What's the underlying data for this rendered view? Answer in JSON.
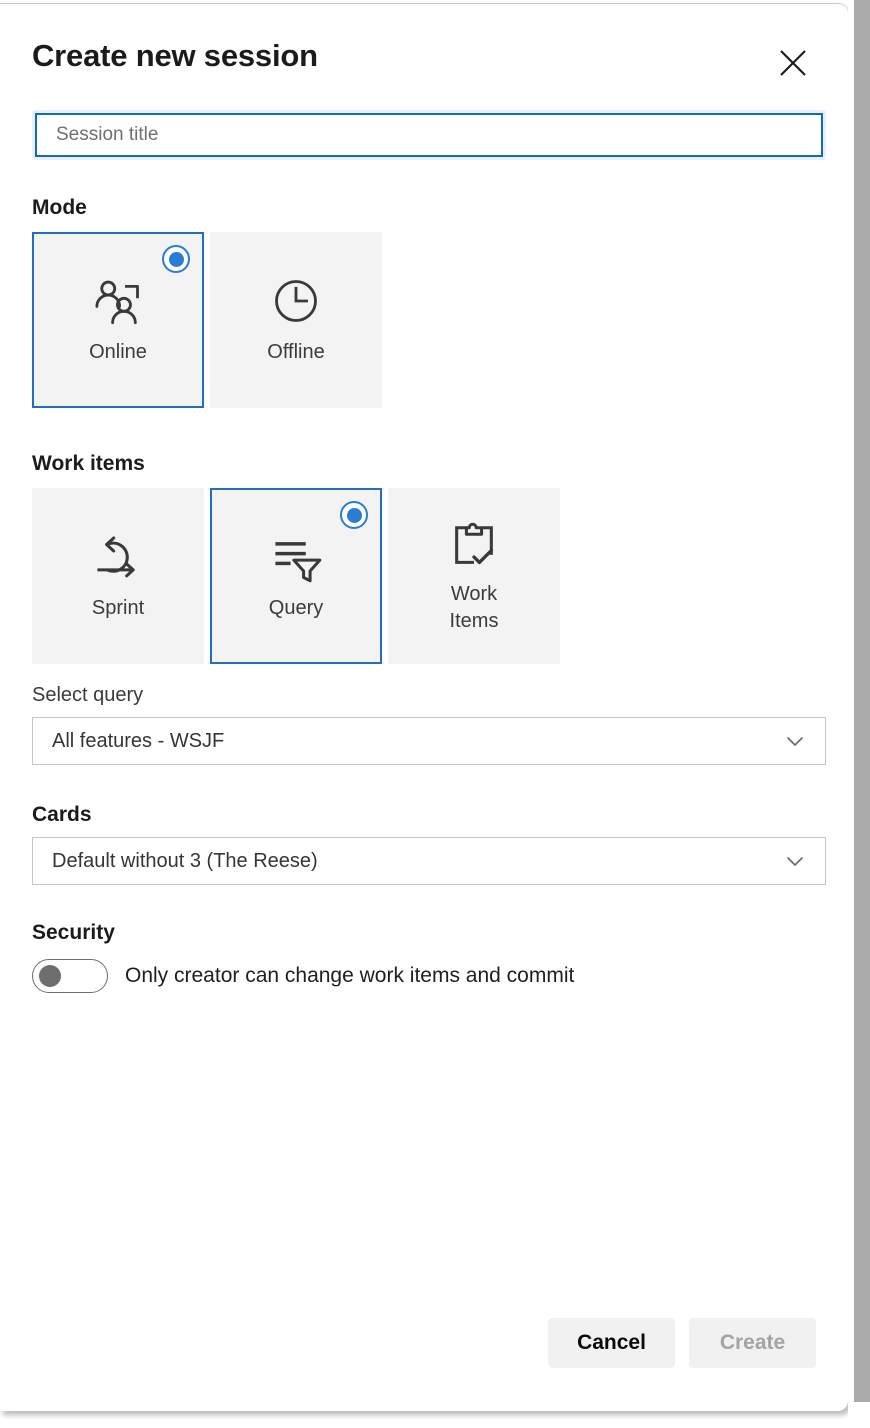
{
  "dialog": {
    "title": "Create new session",
    "close_icon": "close-icon"
  },
  "session_title": {
    "value": "",
    "placeholder": "Session title"
  },
  "mode": {
    "heading": "Mode",
    "selected": "Online",
    "options": [
      {
        "label": "Online",
        "icon": "people-group-icon",
        "selected": true
      },
      {
        "label": "Offline",
        "icon": "clock-icon",
        "selected": false
      }
    ]
  },
  "work_items": {
    "heading": "Work items",
    "selected": "Query",
    "options": [
      {
        "label": "Sprint",
        "icon": "sprint-loop-icon",
        "selected": false
      },
      {
        "label": "Query",
        "icon": "filter-lines-icon",
        "selected": true
      },
      {
        "label": "Work\nItems",
        "icon": "clipboard-check-icon",
        "selected": false
      }
    ],
    "query_field": {
      "label": "Select query",
      "value": "All features - WSJF",
      "chevron_icon": "chevron-down-icon"
    }
  },
  "cards": {
    "heading": "Cards",
    "value": "Default without 3 (The Reese)",
    "chevron_icon": "chevron-down-icon"
  },
  "security": {
    "heading": "Security",
    "toggle_label": "Only creator can change work items and commit",
    "toggle_on": false
  },
  "footer": {
    "cancel_label": "Cancel",
    "create_label": "Create",
    "create_disabled": true
  },
  "colors": {
    "accent": "#2b7cd3",
    "selected_border": "#1f6fc4",
    "input_focus": "#0f6cbd",
    "card_bg": "#f3f3f3",
    "text": "#1b1b1b",
    "muted_text": "#707070",
    "disabled_text": "#a3a3a3",
    "scrollbar": "#aaaaaa"
  }
}
